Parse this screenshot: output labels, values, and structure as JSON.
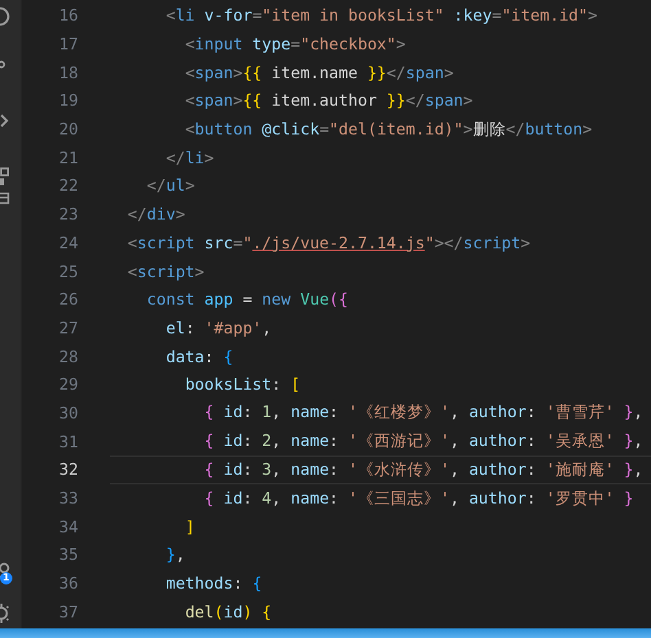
{
  "activity_bar": {
    "badge": "1"
  },
  "editor": {
    "lines": [
      {
        "number": "16",
        "active": false,
        "tokens": [
          {
            "kind": "p",
            "text": "        <"
          },
          {
            "kind": "tag",
            "text": "li"
          },
          {
            "kind": "attr",
            "text": " v-for"
          },
          {
            "kind": "p",
            "text": "="
          },
          {
            "kind": "str",
            "text": "\"item in booksList\""
          },
          {
            "kind": "attr",
            "text": " :key"
          },
          {
            "kind": "p",
            "text": "="
          },
          {
            "kind": "str",
            "text": "\"item.id\""
          },
          {
            "kind": "p",
            "text": ">"
          }
        ]
      },
      {
        "number": "17",
        "active": false,
        "tokens": [
          {
            "kind": "p",
            "text": "          <"
          },
          {
            "kind": "tag",
            "text": "input"
          },
          {
            "kind": "attr",
            "text": " type"
          },
          {
            "kind": "p",
            "text": "="
          },
          {
            "kind": "str",
            "text": "\"checkbox\""
          },
          {
            "kind": "p",
            "text": ">"
          }
        ]
      },
      {
        "number": "18",
        "active": false,
        "tokens": [
          {
            "kind": "p",
            "text": "          <"
          },
          {
            "kind": "tag",
            "text": "span"
          },
          {
            "kind": "p",
            "text": ">"
          },
          {
            "kind": "b1",
            "text": "{{"
          },
          {
            "kind": "plain",
            "text": " item.name "
          },
          {
            "kind": "b1",
            "text": "}}"
          },
          {
            "kind": "p",
            "text": "</"
          },
          {
            "kind": "tag",
            "text": "span"
          },
          {
            "kind": "p",
            "text": ">"
          }
        ]
      },
      {
        "number": "19",
        "active": false,
        "tokens": [
          {
            "kind": "p",
            "text": "          <"
          },
          {
            "kind": "tag",
            "text": "span"
          },
          {
            "kind": "p",
            "text": ">"
          },
          {
            "kind": "b1",
            "text": "{{"
          },
          {
            "kind": "plain",
            "text": " item.author "
          },
          {
            "kind": "b1",
            "text": "}}"
          },
          {
            "kind": "p",
            "text": "</"
          },
          {
            "kind": "tag",
            "text": "span"
          },
          {
            "kind": "p",
            "text": ">"
          }
        ]
      },
      {
        "number": "20",
        "active": false,
        "tokens": [
          {
            "kind": "p",
            "text": "          <"
          },
          {
            "kind": "tag",
            "text": "button"
          },
          {
            "kind": "attr",
            "text": " @click"
          },
          {
            "kind": "p",
            "text": "="
          },
          {
            "kind": "str",
            "text": "\"del(item.id)\""
          },
          {
            "kind": "p",
            "text": ">"
          },
          {
            "kind": "plain",
            "text": "删除"
          },
          {
            "kind": "p",
            "text": "</"
          },
          {
            "kind": "tag",
            "text": "button"
          },
          {
            "kind": "p",
            "text": ">"
          }
        ]
      },
      {
        "number": "21",
        "active": false,
        "tokens": [
          {
            "kind": "p",
            "text": "        </"
          },
          {
            "kind": "tag",
            "text": "li"
          },
          {
            "kind": "p",
            "text": ">"
          }
        ]
      },
      {
        "number": "22",
        "active": false,
        "tokens": [
          {
            "kind": "p",
            "text": "      </"
          },
          {
            "kind": "tag",
            "text": "ul"
          },
          {
            "kind": "p",
            "text": ">"
          }
        ]
      },
      {
        "number": "23",
        "active": false,
        "tokens": [
          {
            "kind": "p",
            "text": "    </"
          },
          {
            "kind": "tag",
            "text": "div"
          },
          {
            "kind": "p",
            "text": ">"
          }
        ]
      },
      {
        "number": "24",
        "active": false,
        "tokens": [
          {
            "kind": "p",
            "text": "    <"
          },
          {
            "kind": "tag",
            "text": "script"
          },
          {
            "kind": "attr",
            "text": " src"
          },
          {
            "kind": "p",
            "text": "="
          },
          {
            "kind": "str",
            "text": "\""
          },
          {
            "kind": "link",
            "text": "./js/vue-2.7.14.js"
          },
          {
            "kind": "str",
            "text": "\""
          },
          {
            "kind": "p",
            "text": "></"
          },
          {
            "kind": "tag",
            "text": "script"
          },
          {
            "kind": "p",
            "text": ">"
          }
        ]
      },
      {
        "number": "25",
        "active": false,
        "tokens": [
          {
            "kind": "p",
            "text": "    <"
          },
          {
            "kind": "tag",
            "text": "script"
          },
          {
            "kind": "p",
            "text": ">"
          }
        ]
      },
      {
        "number": "26",
        "active": false,
        "tokens": [
          {
            "kind": "kw",
            "text": "      const"
          },
          {
            "kind": "var",
            "text": " app"
          },
          {
            "kind": "plain",
            "text": " = "
          },
          {
            "kind": "kw",
            "text": "new"
          },
          {
            "kind": "cls",
            "text": " Vue"
          },
          {
            "kind": "b2",
            "text": "({"
          }
        ]
      },
      {
        "number": "27",
        "active": false,
        "tokens": [
          {
            "kind": "prop",
            "text": "        el"
          },
          {
            "kind": "plain",
            "text": ": "
          },
          {
            "kind": "str",
            "text": "'#app'"
          },
          {
            "kind": "plain",
            "text": ","
          }
        ]
      },
      {
        "number": "28",
        "active": false,
        "tokens": [
          {
            "kind": "prop",
            "text": "        data"
          },
          {
            "kind": "plain",
            "text": ": "
          },
          {
            "kind": "b3",
            "text": "{"
          }
        ]
      },
      {
        "number": "29",
        "active": false,
        "tokens": [
          {
            "kind": "prop",
            "text": "          booksList"
          },
          {
            "kind": "plain",
            "text": ": "
          },
          {
            "kind": "b1",
            "text": "["
          }
        ]
      },
      {
        "number": "30",
        "active": false,
        "tokens": [
          {
            "kind": "b2",
            "text": "            {"
          },
          {
            "kind": "prop",
            "text": " id"
          },
          {
            "kind": "plain",
            "text": ": "
          },
          {
            "kind": "num",
            "text": "1"
          },
          {
            "kind": "plain",
            "text": ", "
          },
          {
            "kind": "prop",
            "text": "name"
          },
          {
            "kind": "plain",
            "text": ": "
          },
          {
            "kind": "str",
            "text": "'《红楼梦》'"
          },
          {
            "kind": "plain",
            "text": ", "
          },
          {
            "kind": "prop",
            "text": "author"
          },
          {
            "kind": "plain",
            "text": ": "
          },
          {
            "kind": "str",
            "text": "'曹雪芹'"
          },
          {
            "kind": "b2",
            "text": " }"
          },
          {
            "kind": "plain",
            "text": ","
          }
        ]
      },
      {
        "number": "31",
        "active": false,
        "tokens": [
          {
            "kind": "b2",
            "text": "            {"
          },
          {
            "kind": "prop",
            "text": " id"
          },
          {
            "kind": "plain",
            "text": ": "
          },
          {
            "kind": "num",
            "text": "2"
          },
          {
            "kind": "plain",
            "text": ", "
          },
          {
            "kind": "prop",
            "text": "name"
          },
          {
            "kind": "plain",
            "text": ": "
          },
          {
            "kind": "str",
            "text": "'《西游记》'"
          },
          {
            "kind": "plain",
            "text": ", "
          },
          {
            "kind": "prop",
            "text": "author"
          },
          {
            "kind": "plain",
            "text": ": "
          },
          {
            "kind": "str",
            "text": "'吴承恩'"
          },
          {
            "kind": "b2",
            "text": " }"
          },
          {
            "kind": "plain",
            "text": ","
          }
        ]
      },
      {
        "number": "32",
        "active": true,
        "tokens": [
          {
            "kind": "b2",
            "text": "            {"
          },
          {
            "kind": "prop",
            "text": " id"
          },
          {
            "kind": "plain",
            "text": ": "
          },
          {
            "kind": "num",
            "text": "3"
          },
          {
            "kind": "plain",
            "text": ", "
          },
          {
            "kind": "prop",
            "text": "name"
          },
          {
            "kind": "plain",
            "text": ": "
          },
          {
            "kind": "str",
            "text": "'《水浒传》'"
          },
          {
            "kind": "plain",
            "text": ", "
          },
          {
            "kind": "prop",
            "text": "author"
          },
          {
            "kind": "plain",
            "text": ": "
          },
          {
            "kind": "str",
            "text": "'施耐庵'"
          },
          {
            "kind": "b2",
            "text": " }"
          },
          {
            "kind": "plain",
            "text": ","
          }
        ]
      },
      {
        "number": "33",
        "active": false,
        "tokens": [
          {
            "kind": "b2",
            "text": "            {"
          },
          {
            "kind": "prop",
            "text": " id"
          },
          {
            "kind": "plain",
            "text": ": "
          },
          {
            "kind": "num",
            "text": "4"
          },
          {
            "kind": "plain",
            "text": ", "
          },
          {
            "kind": "prop",
            "text": "name"
          },
          {
            "kind": "plain",
            "text": ": "
          },
          {
            "kind": "str",
            "text": "'《三国志》'"
          },
          {
            "kind": "plain",
            "text": ", "
          },
          {
            "kind": "prop",
            "text": "author"
          },
          {
            "kind": "plain",
            "text": ": "
          },
          {
            "kind": "str",
            "text": "'罗贯中'"
          },
          {
            "kind": "b2",
            "text": " }"
          }
        ]
      },
      {
        "number": "34",
        "active": false,
        "tokens": [
          {
            "kind": "b1",
            "text": "          ]"
          }
        ]
      },
      {
        "number": "35",
        "active": false,
        "tokens": [
          {
            "kind": "b3",
            "text": "        }"
          },
          {
            "kind": "plain",
            "text": ","
          }
        ]
      },
      {
        "number": "36",
        "active": false,
        "tokens": [
          {
            "kind": "prop",
            "text": "        methods"
          },
          {
            "kind": "plain",
            "text": ": "
          },
          {
            "kind": "b3",
            "text": "{"
          }
        ]
      },
      {
        "number": "37",
        "active": false,
        "tokens": [
          {
            "kind": "fn",
            "text": "          del"
          },
          {
            "kind": "b1",
            "text": "("
          },
          {
            "kind": "prop",
            "text": "id"
          },
          {
            "kind": "b1",
            "text": ")"
          },
          {
            "kind": "b1",
            "text": " {"
          }
        ]
      }
    ]
  }
}
